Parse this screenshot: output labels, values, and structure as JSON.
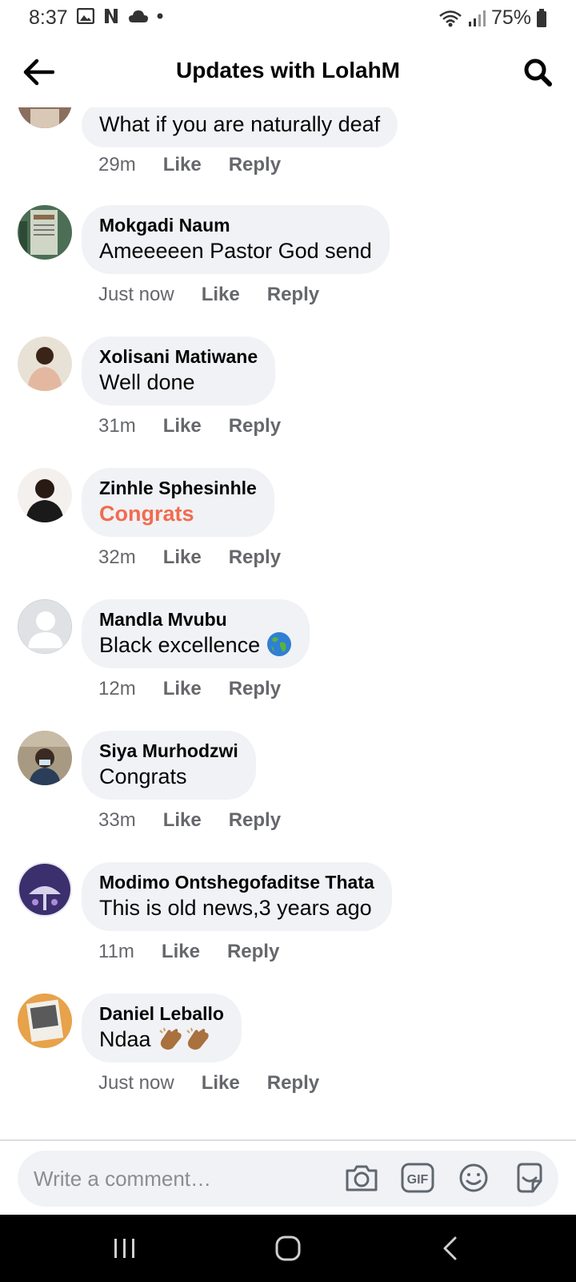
{
  "status_bar": {
    "time": "8:37",
    "battery": "75%"
  },
  "header": {
    "title": "Updates with LolahM"
  },
  "actions": {
    "like": "Like",
    "reply": "Reply"
  },
  "comments": [
    {
      "name": "",
      "text": "What if you are naturally deaf",
      "time": "29m"
    },
    {
      "name": "Mokgadi Naum",
      "text": "Ameeeeen Pastor God send",
      "time": "Just now"
    },
    {
      "name": "Xolisani Matiwane",
      "text": "Well done",
      "time": "31m"
    },
    {
      "name": "Zinhle Sphesinhle",
      "text": "Congrats",
      "time": "32m"
    },
    {
      "name": "Mandla Mvubu",
      "text": "Black excellence",
      "time": "12m"
    },
    {
      "name": "Siya Murhodzwi",
      "text": "Congrats",
      "time": "33m"
    },
    {
      "name": "Modimo Ontshegofaditse Thata",
      "text": "This is old news,3 years ago",
      "time": "11m"
    },
    {
      "name": "Daniel Leballo",
      "text": "Ndaa",
      "time": "Just now"
    }
  ],
  "composer": {
    "placeholder": "Write a comment…"
  },
  "colors": {
    "bubble": "#f0f2f5",
    "accent_text": "#f26b4f",
    "meta": "#65676b"
  }
}
